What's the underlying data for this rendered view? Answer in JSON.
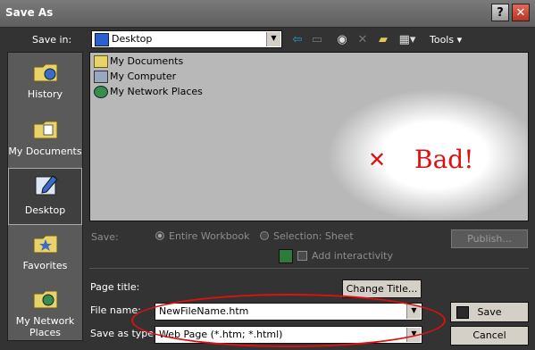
{
  "window": {
    "title": "Save As",
    "help_glyph": "?",
    "close_glyph": "✕"
  },
  "toolbar": {
    "save_in_label": "Save in:",
    "save_in_value": "Desktop",
    "tools_label": "Tools"
  },
  "places": [
    {
      "label": "History"
    },
    {
      "label": "My Documents"
    },
    {
      "label": "Desktop"
    },
    {
      "label": "Favorites"
    },
    {
      "label": "My Network Places"
    }
  ],
  "files": [
    {
      "label": "My Documents"
    },
    {
      "label": "My Computer"
    },
    {
      "label": "My Network Places"
    }
  ],
  "annotation": {
    "mark": "✕",
    "text": "Bad!",
    "color": "#e01010"
  },
  "save_options": {
    "label": "Save:",
    "entire_workbook": "Entire Workbook",
    "selection": "Selection: Sheet",
    "publish_button": "Publish...",
    "add_interactivity": "Add interactivity"
  },
  "page_title": {
    "label": "Page title:",
    "change_button": "Change Title..."
  },
  "file_name": {
    "label": "File name:",
    "value": "NewFileName.htm"
  },
  "save_as_type": {
    "label": "Save as type:",
    "value": "Web Page (*.htm; *.html)"
  },
  "buttons": {
    "save": "Save",
    "cancel": "Cancel"
  }
}
